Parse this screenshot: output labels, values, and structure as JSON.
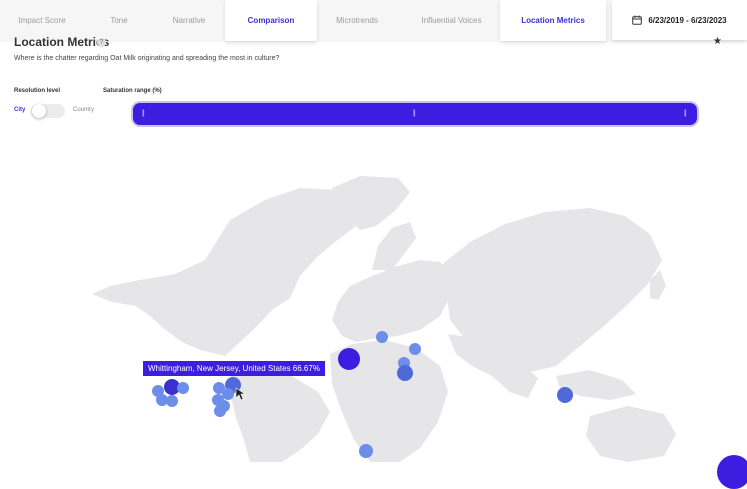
{
  "tabs": [
    {
      "label": "Impact Score",
      "active": false
    },
    {
      "label": "Tone",
      "active": false
    },
    {
      "label": "Narrative",
      "active": false
    },
    {
      "label": "Comparison",
      "active": true
    },
    {
      "label": "Microtrends",
      "active": false
    },
    {
      "label": "Influential Voices",
      "active": false
    },
    {
      "label": "Location Metrics",
      "active": true
    }
  ],
  "date_range": {
    "icon": "calendar-icon",
    "label": "6/23/2019 - 6/23/2023"
  },
  "section": {
    "title": "Location Metrics",
    "help_glyph": "?",
    "pin_icon": "pin-icon",
    "subtitle": "Where is the chatter regarding Oat Milk originating and spreading the most in culture?"
  },
  "controls": {
    "resolution_label": "Resolution level",
    "option_city": "City",
    "option_country": "Country",
    "selected": "City",
    "saturation_label": "Saturation range (%)",
    "saturation_low_pct": 0,
    "saturation_mid_pct": 50,
    "saturation_high_pct": 100
  },
  "map": {
    "tooltip": "Whittingham, New Jersey, United States 66.67%",
    "colors": {
      "accent": "#3d1ee0",
      "point_light": "#6d8ee8",
      "point_mid": "#4f6ad8",
      "point_dark": "#3a2fd0",
      "land": "#e6e6e9"
    }
  }
}
